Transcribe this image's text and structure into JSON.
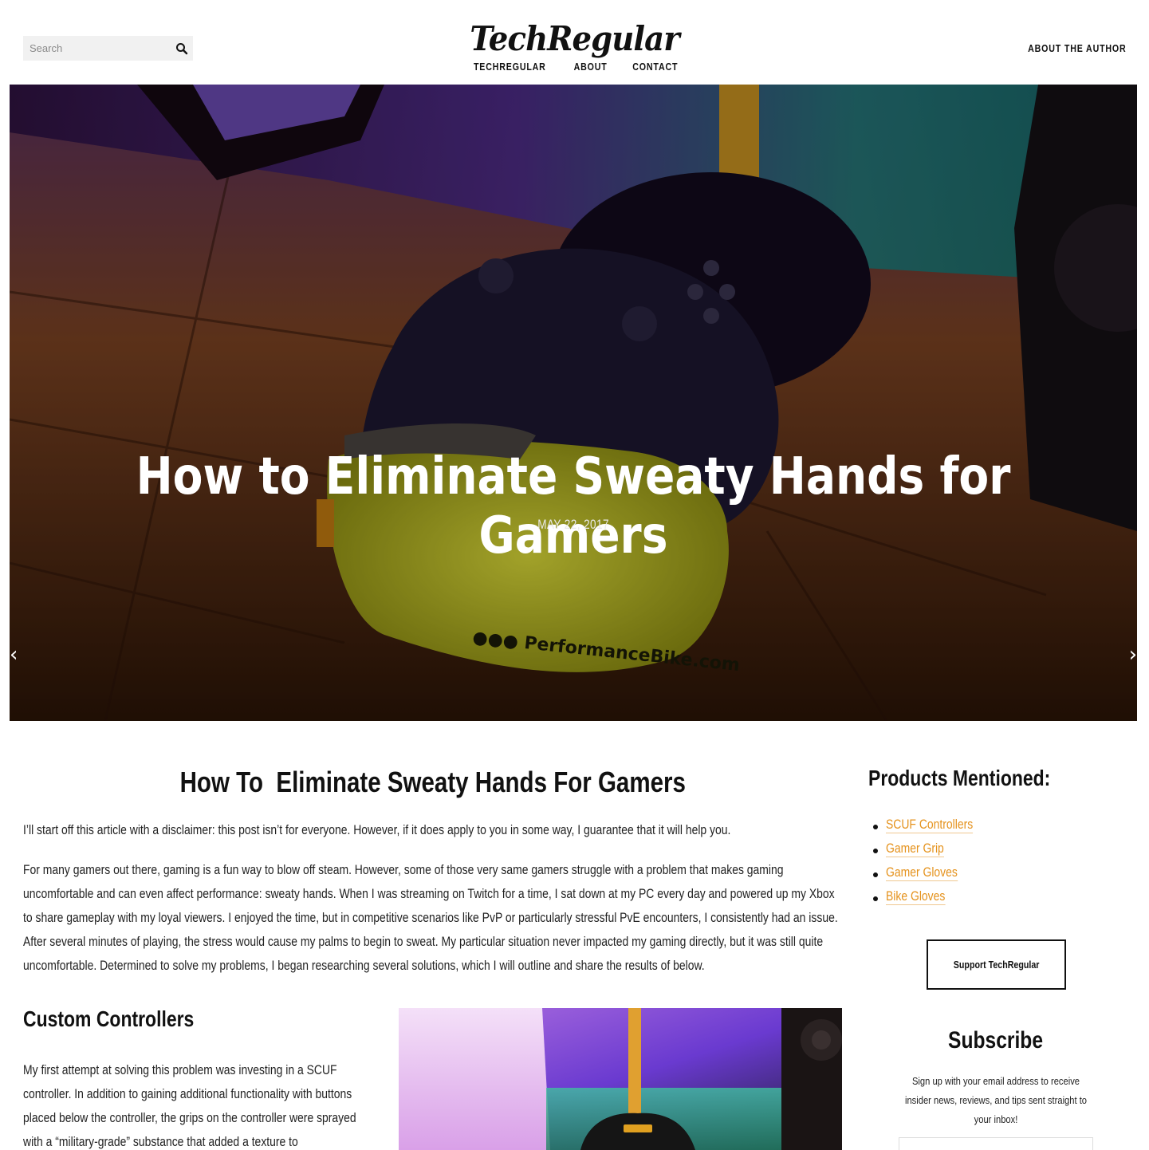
{
  "header": {
    "search_placeholder": "Search",
    "logo": "TechRegular",
    "nav": [
      "TECHREGULAR",
      "ABOUT",
      "CONTACT"
    ],
    "author_link": "ABOUT THE AUTHOR"
  },
  "hero": {
    "title": "How to Eliminate Sweaty Hands for Gamers",
    "date": "MAY 22, 2017",
    "prev_icon": "chevron-left-icon",
    "next_icon": "chevron-right-icon"
  },
  "article": {
    "title": "How To  Eliminate Sweaty Hands For Gamers",
    "paragraphs": [
      "I’ll start off this article with a disclaimer: this post isn’t for everyone. However, if it does apply to you in some way, I guarantee that it will help you.",
      "For many gamers out there, gaming is a fun way to blow off steam. However, some of those very same gamers struggle with a problem that makes gaming uncomfortable and can even affect performance: sweaty hands. When I was streaming on Twitch for a time, I sat down at my PC every day and powered up my Xbox to share gameplay with my loyal viewers. I enjoyed the time, but in competitive scenarios like PvP or particularly stressful PvE encounters, I consistently had an issue. After several minutes of playing, the stress would cause my palms to begin to sweat. My particular situation never impacted my gaming directly, but it was still quite uncomfortable. Determined to solve my problems, I began researching several solutions, which I will outline and share the results of below."
    ],
    "section_title": "Custom Controllers",
    "section_text": "My first attempt at solving this problem was investing in a SCUF controller. In addition to gaining additional functionality with buttons placed below the controller, the grips on the controller were sprayed with a “military-grade” substance that added a texture to"
  },
  "sidebar": {
    "products_title": "Products Mentioned:",
    "products": [
      "SCUF Controllers",
      "Gamer Grip",
      "Gamer Gloves",
      "Bike Gloves"
    ],
    "support_label": "Support TechRegular",
    "subscribe_title": "Subscribe",
    "subscribe_text": "Sign up with your email address to receive insider news, reviews, and tips sent straight to your inbox!"
  },
  "colors": {
    "accent": "#e5921c",
    "text": "#111111",
    "search_bg": "#f1f1f1"
  }
}
